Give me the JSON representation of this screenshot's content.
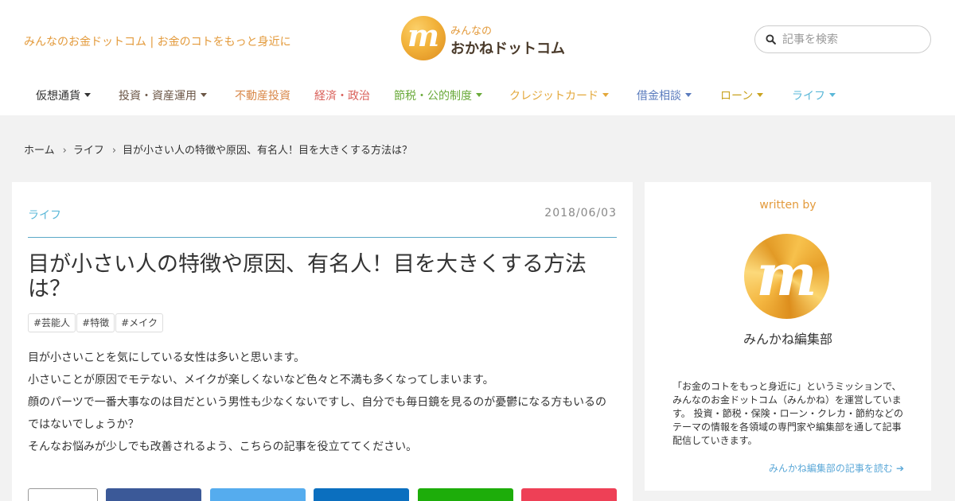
{
  "header": {
    "tagline": "みんなのお金ドットコム | お金のコトをもっと身近に",
    "logo": {
      "small": "みんなの",
      "big": "おかねドットコム",
      "mark": "m"
    },
    "search": {
      "placeholder": "記事を検索",
      "value": ""
    }
  },
  "nav": {
    "items": [
      {
        "label": "仮想通貨",
        "has_dropdown": true,
        "color": "#333333"
      },
      {
        "label": "投資・資産運用",
        "has_dropdown": true,
        "color": "#6b5646"
      },
      {
        "label": "不動産投資",
        "has_dropdown": false,
        "color": "#d9884a"
      },
      {
        "label": "経済・政治",
        "has_dropdown": false,
        "color": "#d9605a"
      },
      {
        "label": "節税・公的制度",
        "has_dropdown": true,
        "color": "#6aaa3a"
      },
      {
        "label": "クレジットカード",
        "has_dropdown": true,
        "color": "#e3a83b"
      },
      {
        "label": "借金相談",
        "has_dropdown": true,
        "color": "#5a7bbd"
      },
      {
        "label": "ローン",
        "has_dropdown": true,
        "color": "#c9a320"
      },
      {
        "label": "ライフ",
        "has_dropdown": true,
        "color": "#5bb8d8"
      }
    ]
  },
  "breadcrumb": {
    "items": [
      "ホーム",
      "ライフ",
      "目が小さい人の特徴や原因、有名人！目を大きくする方法は？"
    ],
    "separator": "›"
  },
  "article": {
    "category": "ライフ",
    "date": "2018/06/03",
    "title": "目が小さい人の特徴や原因、有名人！目を大きくする方法は？",
    "tags": [
      "#芸能人",
      "#特徴",
      "#メイク"
    ],
    "paragraphs": [
      "目が小さいことを気にしている女性は多いと思います。",
      "小さいことが原因でモテない、メイクが楽しくないなど色々と不満も多くなってしまいます。",
      "顔のパーツで一番大事なのは目だという男性も少なくないですし、自分でも毎日鏡を見るのが憂鬱になる方もいるのではないでしょうか？",
      "そんなお悩みが少しでも改善されるよう、こちらの記事を役立ててください。"
    ],
    "share_buttons": [
      {
        "name": "share-count",
        "color": "#ffffff"
      },
      {
        "name": "facebook",
        "color": "#3b5998"
      },
      {
        "name": "twitter",
        "color": "#55acee"
      },
      {
        "name": "hatena",
        "color": "#0b6fbf"
      },
      {
        "name": "line",
        "color": "#1dad0a"
      },
      {
        "name": "pocket",
        "color": "#ee4056"
      }
    ]
  },
  "sidebar": {
    "written_by": "written by",
    "author": "みんかね編集部",
    "description": "「お金のコトをもっと身近に」というミッションで、みんなのお金ドットコム（みんかね）を運営しています。 投資・節税・保険・ローン・クレカ・節約などのテーマの情報を各領域の専門家や編集部を通して記事配信していきます。",
    "more_link": "みんかね編集部の記事を読む",
    "avatar_mark": "m"
  },
  "colors": {
    "accent": "#e39a3b",
    "link": "#5ba8d8",
    "rule": "#5ba8c8",
    "background": "#f2f2f2"
  },
  "icons": {
    "search": "search-icon",
    "dropdown": "caret-down-icon",
    "more_arrow": "arrow-right-icon"
  }
}
